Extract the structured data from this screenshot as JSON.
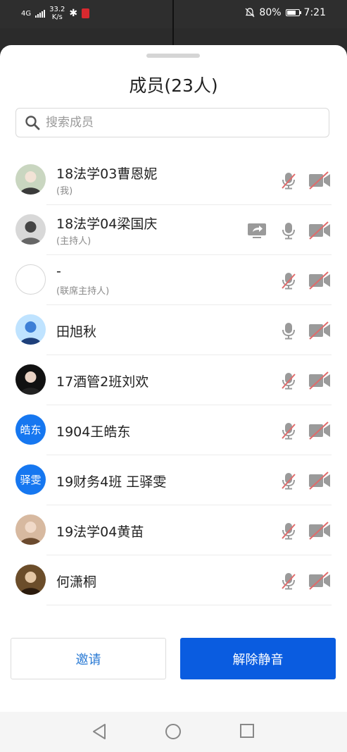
{
  "status_bar": {
    "network": "4G",
    "speed_value": "33.2",
    "speed_unit": "K/s",
    "battery": "80%",
    "time": "7:21"
  },
  "sheet": {
    "title": "成员(23人)",
    "search_placeholder": "搜索成员"
  },
  "members": [
    {
      "name": "18法学03曹恩妮",
      "role": "(我)",
      "avatar": "photo",
      "mic_muted": true,
      "cam_off": true,
      "sharing": false
    },
    {
      "name": "18法学04梁国庆",
      "role": "(主持人)",
      "avatar": "photo",
      "mic_muted": false,
      "cam_off": true,
      "sharing": true
    },
    {
      "name": "-",
      "role": "(联席主持人)",
      "avatar": "empty",
      "mic_muted": true,
      "cam_off": true,
      "sharing": false
    },
    {
      "name": "田旭秋",
      "role": "",
      "avatar": "photo",
      "mic_muted": false,
      "cam_off": true,
      "sharing": false
    },
    {
      "name": "17酒管2班刘欢",
      "role": "",
      "avatar": "photo",
      "mic_muted": true,
      "cam_off": true,
      "sharing": false
    },
    {
      "name": "1904王皓东",
      "role": "",
      "avatar": "text",
      "avatar_text": "皓东",
      "mic_muted": true,
      "cam_off": true,
      "sharing": false
    },
    {
      "name": "19财务4班 王驿雯",
      "role": "",
      "avatar": "text",
      "avatar_text": "驿雯",
      "mic_muted": true,
      "cam_off": true,
      "sharing": false
    },
    {
      "name": "19法学04黄苗",
      "role": "",
      "avatar": "photo",
      "mic_muted": true,
      "cam_off": true,
      "sharing": false
    },
    {
      "name": "何潇桐",
      "role": "",
      "avatar": "photo",
      "mic_muted": true,
      "cam_off": true,
      "sharing": false
    }
  ],
  "buttons": {
    "invite": "邀请",
    "unmute_all": "解除静音"
  },
  "colors": {
    "primary": "#0a5ce0",
    "invite_text": "#2a7ad4",
    "muted_slash": "#e06a6a",
    "icon_gray": "#9a9a9a"
  }
}
